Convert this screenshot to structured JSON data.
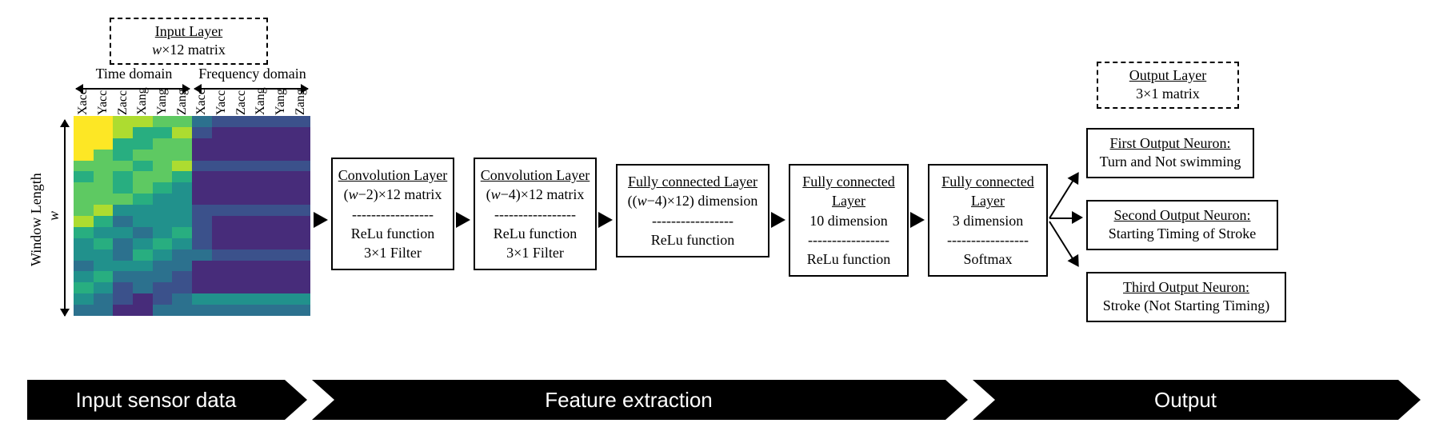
{
  "input_layer": {
    "title": "Input Layer",
    "shape": "w×12 matrix"
  },
  "output_layer": {
    "title": "Output Layer",
    "shape": "3×1 matrix"
  },
  "domains": {
    "time": "Time domain",
    "freq": "Frequency domain"
  },
  "channels": [
    "Xacc",
    "Yacc",
    "Zacc",
    "Xang",
    "Yang",
    "Zang",
    "Xacc",
    "Yacc",
    "Zacc",
    "Xang",
    "Yang",
    "Zang"
  ],
  "window": {
    "label": "Window Length",
    "var": "w"
  },
  "layers": {
    "conv1": {
      "title": "Convolution Layer",
      "shape_pre": "(",
      "shape_var": "w",
      "shape_post": "−2)×12 matrix",
      "act": "ReLu function",
      "filter": "3×1 Filter"
    },
    "conv2": {
      "title": "Convolution Layer",
      "shape_pre": "(",
      "shape_var": "w",
      "shape_post": "−4)×12 matrix",
      "act": "ReLu function",
      "filter": "3×1 Filter"
    },
    "fc1": {
      "title": "Fully connected Layer",
      "shape_pre": "((",
      "shape_var": "w",
      "shape_post": "−4)×12) dimension",
      "act": "ReLu function"
    },
    "fc2": {
      "title": "Fully connected Layer",
      "shape": "10 dimension",
      "act": "ReLu function"
    },
    "fc3": {
      "title": "Fully connected Layer",
      "shape": "3 dimension",
      "act": "Softmax"
    }
  },
  "outputs": {
    "o1": {
      "title": "First Output Neuron:",
      "desc": "Turn and Not swimming"
    },
    "o2": {
      "title": "Second Output Neuron:",
      "desc": "Starting Timing of Stroke"
    },
    "o3": {
      "title": "Third Output Neuron:",
      "desc": "Stroke (Not Starting Timing)"
    }
  },
  "stages": {
    "s1": "Input sensor data",
    "s2": "Feature extraction",
    "s3": "Output"
  },
  "sep": "-----------------"
}
